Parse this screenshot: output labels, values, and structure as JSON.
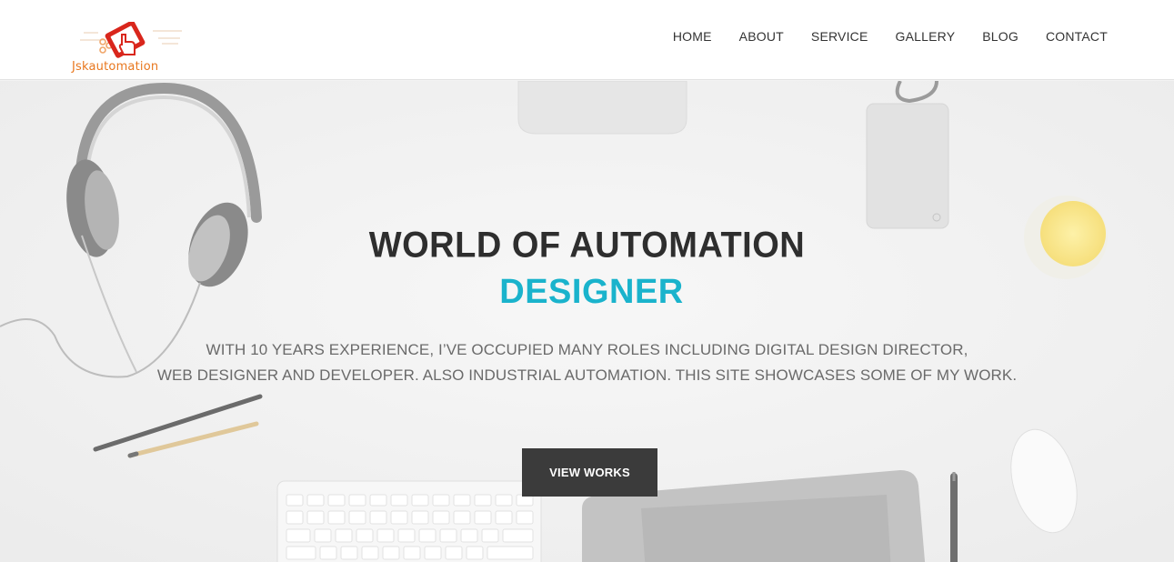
{
  "brand": {
    "logo_text": "Jskautomation",
    "logo_icon": "hand-touch-icon",
    "accent": "#e8771e",
    "icon_red": "#d9261c"
  },
  "nav": {
    "items": [
      {
        "label": "HOME"
      },
      {
        "label": "ABOUT"
      },
      {
        "label": "SERVICE"
      },
      {
        "label": "GALLERY"
      },
      {
        "label": "BLOG"
      },
      {
        "label": "CONTACT"
      }
    ]
  },
  "hero": {
    "title": "WORLD OF AUTOMATION",
    "subtitle": "DESIGNER",
    "subtitle_color": "#1ab3cc",
    "description_line1": "WITH 10 YEARS EXPERIENCE, I’VE OCCUPIED MANY ROLES INCLUDING DIGITAL DESIGN DIRECTOR,",
    "description_line2": "WEB DESIGNER AND DEVELOPER. ALSO INDUSTRIAL AUTOMATION. THIS SITE SHOWCASES SOME OF MY WORK.",
    "button_label": "VIEW WORKS"
  }
}
